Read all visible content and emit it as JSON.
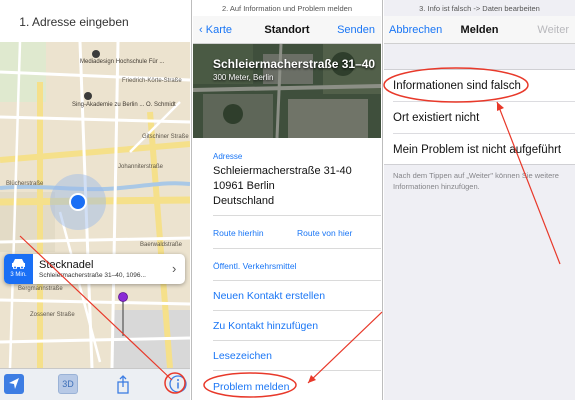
{
  "captions": {
    "step1": "1. Adresse eingeben",
    "step2": "2. Auf Information und Problem melden",
    "step3": "3. Info ist falsch -> Daten bearbeiten"
  },
  "map": {
    "streets": {
      "s1": "Friedrich-Körte-Straße",
      "s2": "Gitschiner Straße",
      "s3": "Blücherstraße",
      "s4": "Bergmannstraße",
      "s5": "Zossener Straße",
      "s6": "Baerwaldstraße",
      "s7": "Johanniterstraße"
    },
    "pois": {
      "poi1": "Mediadesign Hochschule Für ...",
      "poi2": "Sing-Akademie zu Berlin ... O. Schmidt"
    },
    "callout": {
      "travel_time": "3 Min.",
      "title": "Stecknadel",
      "subtitle": "Schleiermacherstraße 31–40, 1096..."
    },
    "toolbar": {
      "three_d_label": "3D"
    }
  },
  "location": {
    "nav": {
      "back_label": "Karte",
      "title": "Standort",
      "send_label": "Senden"
    },
    "header_title": "Schleiermacherstraße 31–40",
    "header_subtitle": "300 Meter, Berlin",
    "address_label": "Adresse",
    "address_lines": {
      "line1": "Schleiermacherstraße 31-40",
      "line2": "10961 Berlin",
      "line3": "Deutschland"
    },
    "route_here": "Route hierhin",
    "route_from_here": "Route von hier",
    "transit": "Öffentl. Verkehrsmittel",
    "actions": {
      "new_contact": "Neuen Kontakt erstellen",
      "add_to_contact": "Zu Kontakt hinzufügen",
      "bookmarks": "Lesezeichen",
      "report_problem": "Problem melden"
    }
  },
  "report": {
    "nav": {
      "cancel_label": "Abbrechen",
      "title": "Melden",
      "next_label": "Weiter"
    },
    "options": [
      "Informationen sind falsch",
      "Ort existiert nicht",
      "Mein Problem ist nicht aufgeführt"
    ],
    "footnote": "Nach dem Tippen auf „Weiter\" können Sie weitere Informationen hinzufügen."
  },
  "colors": {
    "ios_blue": "#1a76f5",
    "annotation_red": "#e8392a",
    "map_background": "#ece3cf"
  }
}
